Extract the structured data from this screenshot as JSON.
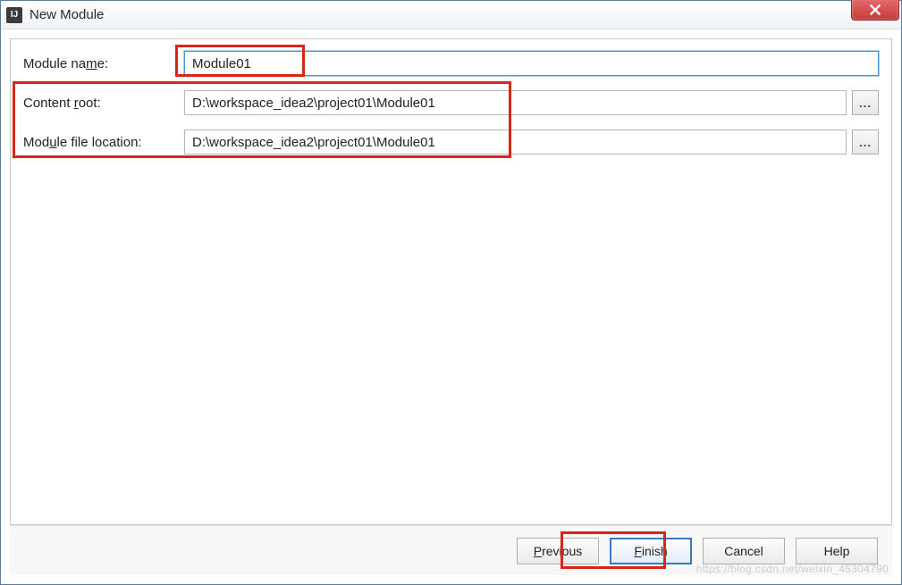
{
  "window": {
    "title": "New Module",
    "app_icon_text": "IJ"
  },
  "form": {
    "module_name": {
      "label_pre": "Module na",
      "label_u": "m",
      "label_post": "e:",
      "value": "Module01"
    },
    "content_root": {
      "label_pre": "Content ",
      "label_u": "r",
      "label_post": "oot:",
      "value": "D:\\workspace_idea2\\project01\\Module01",
      "browse": "..."
    },
    "module_file_location": {
      "label_pre": "Mod",
      "label_u": "u",
      "label_post": "le file location:",
      "value": "D:\\workspace_idea2\\project01\\Module01",
      "browse": "..."
    }
  },
  "buttons": {
    "previous_u": "P",
    "previous_post": "revious",
    "finish_u": "F",
    "finish_post": "inish",
    "cancel": "Cancel",
    "help": "Help"
  },
  "watermark": "https://blog.csdn.net/weixin_45304790"
}
